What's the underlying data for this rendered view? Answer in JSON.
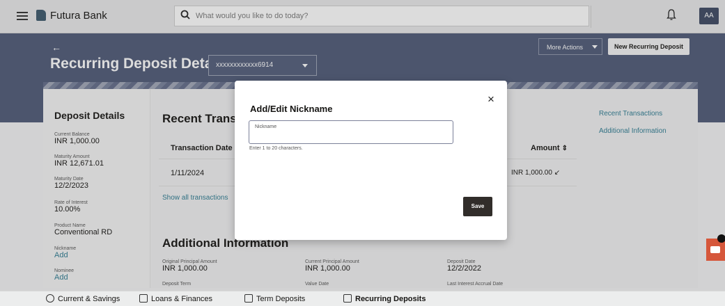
{
  "topbar": {
    "bank_name": "Futura Bank",
    "search_placeholder": "What would you like to do today?",
    "avatar_initials": "AA"
  },
  "header": {
    "back_arrow": "←",
    "page_title": "Recurring Deposit Details",
    "account_number": "xxxxxxxxxxxx6914",
    "more_actions_label": "More Actions",
    "new_rd_label": "New Recurring Deposit"
  },
  "deposit_details": {
    "title": "Deposit Details",
    "items": [
      {
        "label": "Current Balance",
        "value": "INR 1,000.00"
      },
      {
        "label": "Maturity Amount",
        "value": "INR 12,671.01"
      },
      {
        "label": "Maturity Date",
        "value": "12/2/2023"
      },
      {
        "label": "Rate of Interest",
        "value": "10.00%"
      },
      {
        "label": "Product Name",
        "value": "Conventional RD"
      },
      {
        "label": "Nickname",
        "value": "Add"
      },
      {
        "label": "Nominee",
        "value": "Add"
      }
    ]
  },
  "recent_transactions": {
    "title": "Recent Transa",
    "col_date": "Transaction Date",
    "col_amount": "Amount",
    "row_date": "1/11/2024",
    "row_amount": "INR 1,000.00",
    "show_all": "Show all transactions"
  },
  "right_links": [
    "Recent Transactions",
    "Additional Information"
  ],
  "additional_info": {
    "title": "Additional Information",
    "items": [
      {
        "label": "Original Principal Amount",
        "value": "INR 1,000.00"
      },
      {
        "label": "Current Principal Amount",
        "value": "INR 1,000.00"
      },
      {
        "label": "Deposit Date",
        "value": "12/2/2022"
      },
      {
        "label": "Deposit Term",
        "value": ""
      },
      {
        "label": "Value Date",
        "value": ""
      },
      {
        "label": "Last Interest Accrual Date",
        "value": ""
      }
    ]
  },
  "modal": {
    "title": "Add/Edit Nickname",
    "close_glyph": "×",
    "field_label": "Nickname",
    "field_value": "",
    "help_text": "Enter 1 to 20 characters.",
    "save_label": "Save"
  },
  "bottom_nav": [
    "Current & Savings",
    "Loans & Finances",
    "Term Deposits",
    "Recurring Deposits"
  ],
  "colors": {
    "header_band": "#505b78",
    "link": "#2f7d93",
    "save_button": "#312d2a",
    "chat_button": "#d6573b"
  },
  "icons": [
    "hamburger-icon",
    "search-icon",
    "bell-icon",
    "close-icon",
    "sort-icon",
    "chat-icon"
  ]
}
